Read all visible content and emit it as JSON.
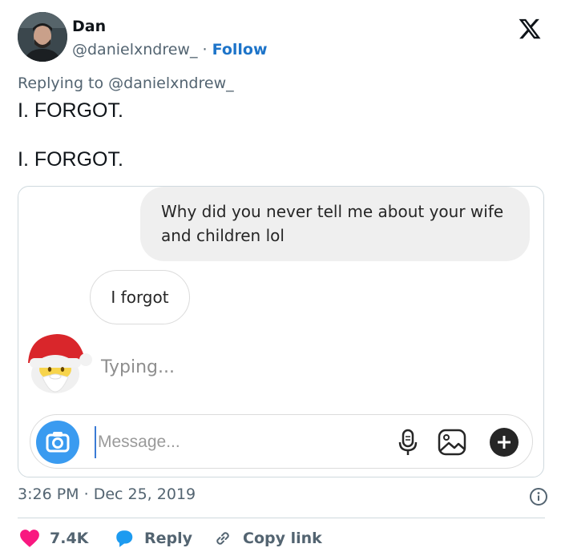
{
  "author": {
    "name": "Dan",
    "handle": "@danielxndrew_",
    "separator": "·",
    "follow_label": "Follow"
  },
  "replying_to": "Replying to @danielxndrew_",
  "tweet_text": {
    "line1": "I. FORGOT.",
    "line2": "I. FORGOT."
  },
  "screenshot": {
    "sent_message": "Why did you never tell me about your wife and children lol",
    "received_message": "I forgot",
    "typing_indicator": "Typing...",
    "message_placeholder": "Message...",
    "icons": [
      "camera-icon",
      "microphone-icon",
      "gallery-icon",
      "plus-icon"
    ],
    "colors": {
      "camera_button": "#3a9bf0",
      "bubble_sent": "#efefef"
    }
  },
  "timestamp": {
    "time": "3:26 PM",
    "separator": "·",
    "date": "Dec 25, 2019"
  },
  "actions": {
    "likes": "7.4K",
    "reply_label": "Reply",
    "copy_label": "Copy link"
  },
  "colors": {
    "follow": "#1d74c9",
    "like": "#f91880",
    "reply": "#1d9bf0",
    "secondary_text": "#536471"
  }
}
